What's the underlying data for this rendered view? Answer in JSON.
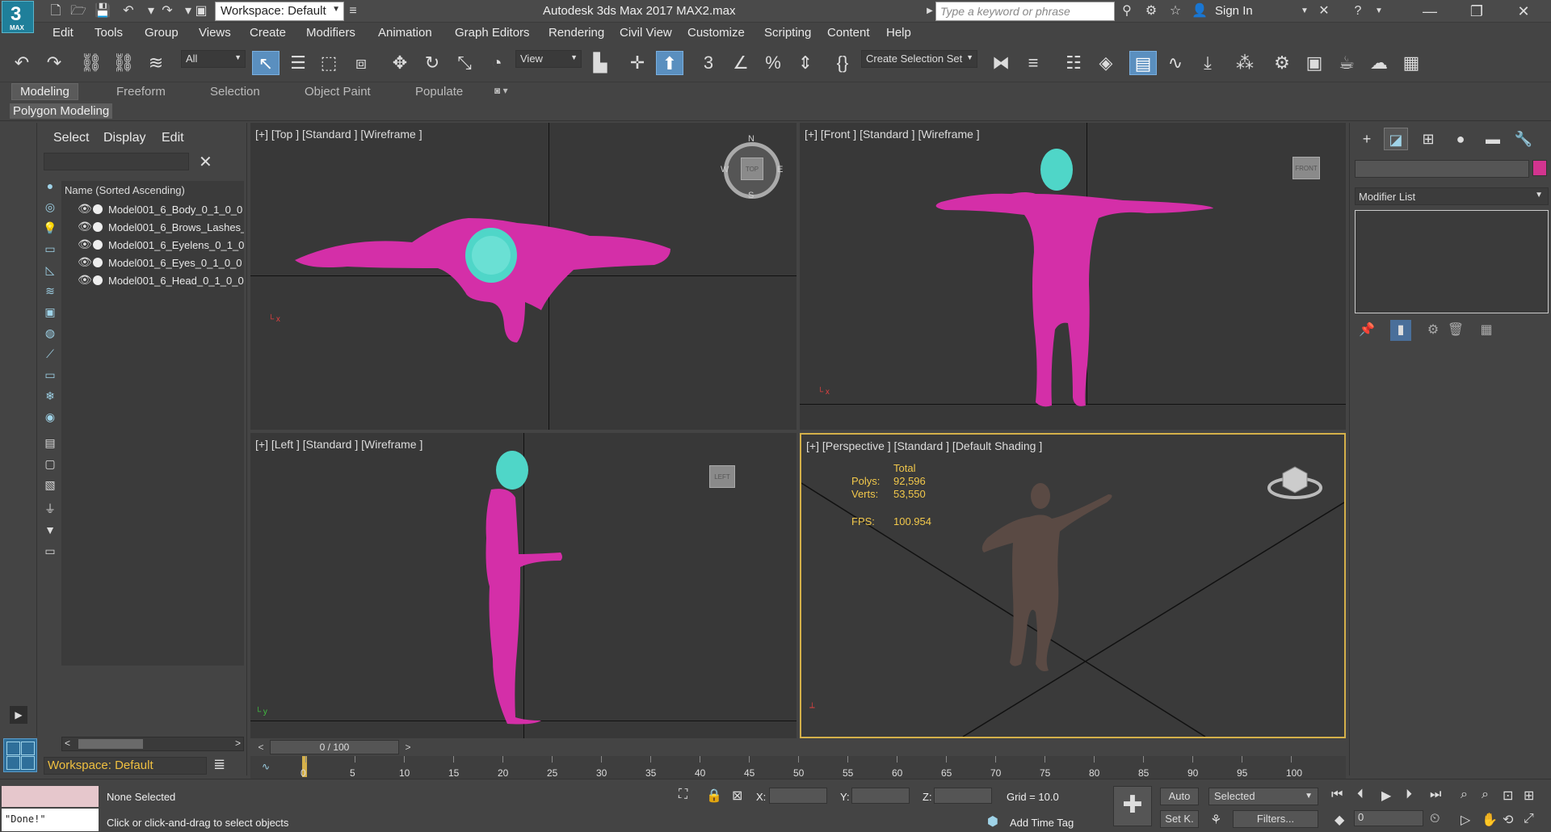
{
  "app": {
    "logo_big": "3",
    "logo_small": "MAX",
    "title": "Autodesk 3ds Max 2017     MAX2.max",
    "workspace": "Workspace: Default",
    "search_placeholder": "Type a keyword or phrase",
    "sign_in": "Sign In"
  },
  "menu": [
    "Edit",
    "Tools",
    "Group",
    "Views",
    "Create",
    "Modifiers",
    "Animation",
    "Graph Editors",
    "Rendering",
    "Civil View",
    "Customize",
    "Scripting",
    "Content",
    "Help"
  ],
  "toolbar": {
    "filter_value": "All",
    "refcoord_value": "View",
    "selection_set_value": "Create Selection Set"
  },
  "ribbon": {
    "tabs": [
      "Modeling",
      "Freeform",
      "Selection",
      "Object Paint",
      "Populate"
    ],
    "active_tab": "Modeling",
    "subtab": "Polygon Modeling"
  },
  "explorer": {
    "tabs": [
      "Select",
      "Display",
      "Edit"
    ],
    "column_header": "Name (Sorted Ascending)",
    "items": [
      "Model001_6_Body_0_1_0_0",
      "Model001_6_Brows_Lashes_",
      "Model001_6_Eyelens_0_1_0_",
      "Model001_6_Eyes_0_1_0_0",
      "Model001_6_Head_0_1_0_0"
    ],
    "workspace": "Workspace: Default"
  },
  "viewports": {
    "top_label": "[+] [Top ] [Standard ] [Wireframe ]",
    "front_label": "[+] [Front ] [Standard ] [Wireframe ]",
    "left_label": "[+] [Left ] [Standard ] [Wireframe ]",
    "persp_label": "[+] [Perspective ] [Standard ] [Default Shading ]",
    "top_cube": "TOP",
    "front_cube": "FRONT",
    "left_cube": "LEFT",
    "compass": {
      "n": "N",
      "s": "S",
      "e": "E",
      "w": "W"
    },
    "stats": {
      "total_label": "Total",
      "polys_label": "Polys:",
      "polys": "92,596",
      "verts_label": "Verts:",
      "verts": "53,550",
      "fps_label": "FPS:",
      "fps": "100.954"
    }
  },
  "command_panel": {
    "modifier_list": "Modifier List",
    "object_color": "#d2348f"
  },
  "timeline": {
    "position": "0 / 100",
    "ticks": [
      "0",
      "5",
      "10",
      "15",
      "20",
      "25",
      "30",
      "35",
      "40",
      "45",
      "50",
      "55",
      "60",
      "65",
      "70",
      "75",
      "80",
      "85",
      "90",
      "95",
      "100"
    ]
  },
  "status": {
    "script_output": "\"Done!\"",
    "selection": "None Selected",
    "prompt": "Click or click-and-drag to select objects",
    "x_label": "X:",
    "y_label": "Y:",
    "z_label": "Z:",
    "grid": "Grid = 10.0",
    "add_time_tag": "Add Time Tag",
    "auto": "Auto",
    "set_key": "Set K.",
    "selected": "Selected",
    "filters": "Filters...",
    "frame": "0"
  },
  "colors": {
    "mesh_magenta": "#d42fa8",
    "head_cyan": "#4fd6c8",
    "accent_yellow": "#f2c84b",
    "active_blue": "#5a8fbf"
  }
}
